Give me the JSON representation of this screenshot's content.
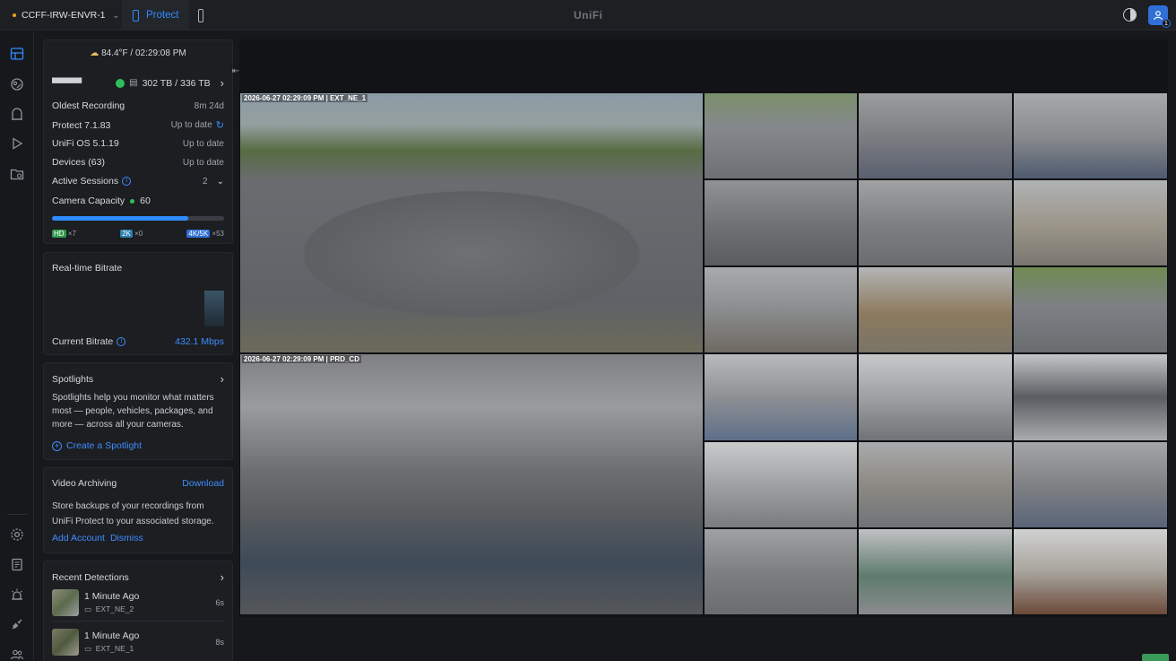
{
  "topbar": {
    "site_name": "CCFF-IRW-ENVR-1",
    "app_tab_label": "Protect",
    "brand": "UniFi",
    "notification_count": "1"
  },
  "weather": {
    "text": "84.4°F / 02:29:08 PM"
  },
  "storage": {
    "device_name": "▀▀▀▀▀",
    "usage": "302 TB / 336 TB"
  },
  "status_rows": [
    {
      "label": "Oldest Recording",
      "value": "8m 24d"
    },
    {
      "label": "Protect 7.1.83",
      "value": "Up to date"
    },
    {
      "label": "UniFi OS 5.1.19",
      "value": "Up to date"
    },
    {
      "label": "Devices (63)",
      "value": "Up to date"
    },
    {
      "label": "Active Sessions",
      "value": "2"
    }
  ],
  "capacity": {
    "label": "Camera Capacity",
    "count": "60",
    "fill_percent": 79,
    "badges": [
      {
        "tag": "HD",
        "count": "×7",
        "color": "#2f9a4a"
      },
      {
        "tag": "2K",
        "count": "×0",
        "color": "#2a7fae"
      },
      {
        "tag": "4K/5K",
        "count": "×53",
        "color": "#2f6fd6"
      }
    ]
  },
  "bitrate": {
    "title": "Real-time Bitrate",
    "current_label": "Current Bitrate",
    "current_value": "432.1 Mbps"
  },
  "spotlights": {
    "title": "Spotlights",
    "description": "Spotlights help you monitor what matters most — people, vehicles, packages, and more — across all your cameras.",
    "create_label": "Create a Spotlight"
  },
  "archiving": {
    "title": "Video Archiving",
    "download_label": "Download",
    "description": "Store backups of your recordings from UniFi Protect to your associated storage.",
    "add_account_label": "Add Account",
    "dismiss_label": "Dismiss"
  },
  "detections": {
    "title": "Recent Detections",
    "items": [
      {
        "time": "1 Minute Ago",
        "camera": "EXT_NE_2",
        "duration": "6s"
      },
      {
        "time": "1 Minute Ago",
        "camera": "EXT_NE_1",
        "duration": "8s"
      }
    ]
  },
  "cameras": {
    "large": [
      {
        "timestamp": "2026-06-27 02:29:09 PM | EXT_NE_1"
      },
      {
        "timestamp": "2026-06-27 02:29:09 PM | PRD_CD"
      }
    ]
  },
  "colors": {
    "accent": "#2f8cff",
    "panel_bg": "#1c1e22",
    "app_bg": "#16181c",
    "status_ok": "#2fbf5a"
  }
}
